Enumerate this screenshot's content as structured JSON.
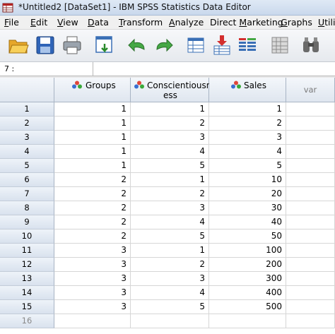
{
  "window": {
    "title": "*Untitled2 [DataSet1] - IBM SPSS Statistics Data Editor"
  },
  "menu": [
    {
      "label": "File",
      "key": "F",
      "rest": "ile"
    },
    {
      "label": "Edit",
      "key": "E",
      "rest": "dit"
    },
    {
      "label": "View",
      "key": "V",
      "rest": "iew"
    },
    {
      "label": "Data",
      "key": "D",
      "rest": "ata"
    },
    {
      "label": "Transform",
      "key": "T",
      "rest": "ransform"
    },
    {
      "label": "Analyze",
      "key": "A",
      "rest": "nalyze"
    },
    {
      "label": "Direct Marketing",
      "key": "",
      "rest": "Direct Marketing",
      "pre": "Direct ",
      "key2": "M",
      "post": "arketing"
    },
    {
      "label": "Graphs",
      "key": "G",
      "rest": "raphs"
    },
    {
      "label": "Utili",
      "key": "U",
      "rest": "tili"
    }
  ],
  "toolbar": {
    "icons": [
      "open-folder-icon",
      "save-icon",
      "print-icon",
      "dialog-recall-icon",
      "undo-icon",
      "redo-icon",
      "go-to-case-icon",
      "insert-cases-icon",
      "insert-variable-icon",
      "split-file-icon",
      "find-icon"
    ]
  },
  "editor": {
    "cell_ref": "7 :",
    "value": ""
  },
  "columns": [
    {
      "name": "Groups",
      "line1": "Groups",
      "line2": "",
      "icon": "nominal-variable-icon"
    },
    {
      "name": "Conscientiousness",
      "line1": "Conscientiousn",
      "line2": "ess",
      "icon": "nominal-variable-icon"
    },
    {
      "name": "Sales",
      "line1": "Sales",
      "line2": "",
      "icon": "nominal-variable-icon"
    },
    {
      "name": "var",
      "line1": "var",
      "line2": "",
      "icon": ""
    }
  ],
  "rows": [
    {
      "n": "1",
      "groups": "1",
      "consc": "1",
      "sales": "1"
    },
    {
      "n": "2",
      "groups": "1",
      "consc": "2",
      "sales": "2"
    },
    {
      "n": "3",
      "groups": "1",
      "consc": "3",
      "sales": "3"
    },
    {
      "n": "4",
      "groups": "1",
      "consc": "4",
      "sales": "4"
    },
    {
      "n": "5",
      "groups": "1",
      "consc": "5",
      "sales": "5"
    },
    {
      "n": "6",
      "groups": "2",
      "consc": "1",
      "sales": "10"
    },
    {
      "n": "7",
      "groups": "2",
      "consc": "2",
      "sales": "20"
    },
    {
      "n": "8",
      "groups": "2",
      "consc": "3",
      "sales": "30"
    },
    {
      "n": "9",
      "groups": "2",
      "consc": "4",
      "sales": "40"
    },
    {
      "n": "10",
      "groups": "2",
      "consc": "5",
      "sales": "50"
    },
    {
      "n": "11",
      "groups": "3",
      "consc": "1",
      "sales": "100"
    },
    {
      "n": "12",
      "groups": "3",
      "consc": "2",
      "sales": "200"
    },
    {
      "n": "13",
      "groups": "3",
      "consc": "3",
      "sales": "300"
    },
    {
      "n": "14",
      "groups": "3",
      "consc": "4",
      "sales": "400"
    },
    {
      "n": "15",
      "groups": "3",
      "consc": "5",
      "sales": "500"
    },
    {
      "n": "16",
      "groups": "",
      "consc": "",
      "sales": ""
    }
  ],
  "colors": {
    "header_bg": "#dfe6ef",
    "grid_line": "#d6d6d6",
    "empty_row_text": "#8a8a8a"
  }
}
